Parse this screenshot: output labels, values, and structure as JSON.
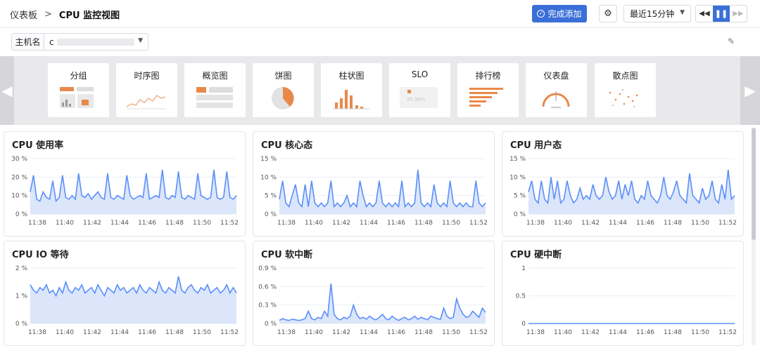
{
  "breadcrumb": {
    "home": "仪表板",
    "separator": ">",
    "title": "CPU 监控视图"
  },
  "toolbar": {
    "done_label": "完成添加",
    "done_icon": "check-circle-icon",
    "settings_icon": "gear-icon",
    "time_range": "最近15分钟",
    "rewind_icon": "rewind-icon",
    "pause_icon": "pause-icon",
    "forward_icon": "fast-forward-icon"
  },
  "host_filter": {
    "label": "主机名",
    "value": "c"
  },
  "gallery": {
    "items": [
      "分组",
      "时序图",
      "概览图",
      "饼图",
      "柱状图",
      "SLO",
      "排行榜",
      "仪表盘",
      "散点图"
    ],
    "slo_preview_text": "95.99%"
  },
  "colors": {
    "accent": "#3b6fd8",
    "line": "#5b8ff9",
    "area": "#dbe6fb",
    "orange": "#e8894a"
  },
  "time_ticks": [
    "11:38",
    "11:40",
    "11:42",
    "11:44",
    "11:46",
    "11:48",
    "11:50",
    "11:52"
  ],
  "panels": [
    {
      "title": "CPU 使用率",
      "y_ticks": [
        "30 %",
        "20 %",
        "10 %",
        "0 %"
      ],
      "y_max": 30,
      "values": [
        12,
        21,
        8,
        7,
        12,
        9,
        8,
        18,
        7,
        9,
        21,
        9,
        8,
        10,
        8,
        22,
        10,
        9,
        11,
        8,
        10,
        12,
        9,
        8,
        22,
        9,
        8,
        10,
        9,
        8,
        21,
        10,
        8,
        9,
        10,
        9,
        22,
        8,
        9,
        10,
        9,
        24,
        9,
        8,
        10,
        9,
        23,
        9,
        8,
        10,
        9,
        8,
        22,
        10,
        9,
        8,
        9,
        24,
        9,
        8,
        9,
        23,
        9,
        8,
        10
      ]
    },
    {
      "title": "CPU 核心态",
      "y_ticks": [
        "15 %",
        "10 %",
        "5 %",
        "0 %"
      ],
      "y_max": 15,
      "values": [
        4,
        9,
        3,
        2,
        5,
        8,
        3,
        2,
        8,
        2,
        9,
        3,
        2,
        3,
        2,
        3,
        9,
        2,
        3,
        2,
        3,
        5,
        2,
        3,
        2,
        9,
        5,
        2,
        3,
        2,
        3,
        9,
        3,
        2,
        3,
        2,
        3,
        2,
        9,
        2,
        3,
        2,
        3,
        12,
        3,
        2,
        3,
        2,
        8,
        3,
        2,
        3,
        2,
        9,
        3,
        2,
        3,
        2,
        3,
        2,
        2,
        9,
        3,
        2,
        3
      ]
    },
    {
      "title": "CPU 用户态",
      "y_ticks": [
        "15 %",
        "10 %",
        "5 %",
        "0 %"
      ],
      "y_max": 15,
      "values": [
        6,
        9,
        4,
        3,
        9,
        4,
        3,
        10,
        4,
        9,
        3,
        4,
        9,
        5,
        3,
        4,
        7,
        4,
        5,
        4,
        8,
        5,
        4,
        5,
        10,
        6,
        4,
        5,
        9,
        4,
        8,
        5,
        9,
        4,
        3,
        5,
        4,
        9,
        5,
        4,
        3,
        5,
        10,
        5,
        4,
        6,
        9,
        5,
        4,
        3,
        11,
        5,
        4,
        3,
        7,
        4,
        5,
        9,
        4,
        3,
        8,
        4,
        12,
        4,
        5
      ]
    },
    {
      "title": "CPU IO 等待",
      "y_ticks": [
        "2 %",
        "1 %",
        "0 %"
      ],
      "y_max": 2,
      "values": [
        1.4,
        1.2,
        1.1,
        1.3,
        1.2,
        1.4,
        1.1,
        1.2,
        1.0,
        1.3,
        1.1,
        1.5,
        1.2,
        1.1,
        1.3,
        1.2,
        1.4,
        1.1,
        1.2,
        1.3,
        1.1,
        1.4,
        1.2,
        1.0,
        1.3,
        1.2,
        1.1,
        1.4,
        1.2,
        1.3,
        1.1,
        1.2,
        1.3,
        1.1,
        1.4,
        1.2,
        1.1,
        1.3,
        1.2,
        1.1,
        1.5,
        1.2,
        1.1,
        1.3,
        1.2,
        1.1,
        1.7,
        1.2,
        1.1,
        1.3,
        1.4,
        1.2,
        1.1,
        1.3,
        1.2,
        1.4,
        1.1,
        1.2,
        1.3,
        1.1,
        1.2,
        1.4,
        1.1,
        1.3,
        1.1
      ]
    },
    {
      "title": "CPU 软中断",
      "y_ticks": [
        "0.9 %",
        "0.6 %",
        "0.3 %",
        "0 %"
      ],
      "y_max": 0.9,
      "values": [
        0.05,
        0.08,
        0.06,
        0.05,
        0.07,
        0.06,
        0.05,
        0.06,
        0.08,
        0.2,
        0.08,
        0.06,
        0.1,
        0.08,
        0.2,
        0.12,
        0.65,
        0.15,
        0.08,
        0.06,
        0.1,
        0.08,
        0.12,
        0.3,
        0.15,
        0.08,
        0.1,
        0.07,
        0.12,
        0.08,
        0.06,
        0.1,
        0.15,
        0.08,
        0.06,
        0.12,
        0.08,
        0.05,
        0.08,
        0.1,
        0.06,
        0.08,
        0.12,
        0.07,
        0.1,
        0.08,
        0.06,
        0.12,
        0.1,
        0.08,
        0.07,
        0.25,
        0.12,
        0.08,
        0.1,
        0.4,
        0.25,
        0.15,
        0.1,
        0.12,
        0.2,
        0.15,
        0.1,
        0.25,
        0.18
      ]
    },
    {
      "title": "CPU 硬中断",
      "y_ticks": [
        "1",
        "0.5",
        "0"
      ],
      "y_max": 1,
      "values": [
        0,
        0,
        0,
        0,
        0,
        0,
        0,
        0,
        0,
        0,
        0,
        0,
        0,
        0,
        0,
        0,
        0,
        0,
        0,
        0,
        0,
        0,
        0,
        0,
        0,
        0,
        0,
        0,
        0,
        0,
        0,
        0
      ]
    }
  ]
}
